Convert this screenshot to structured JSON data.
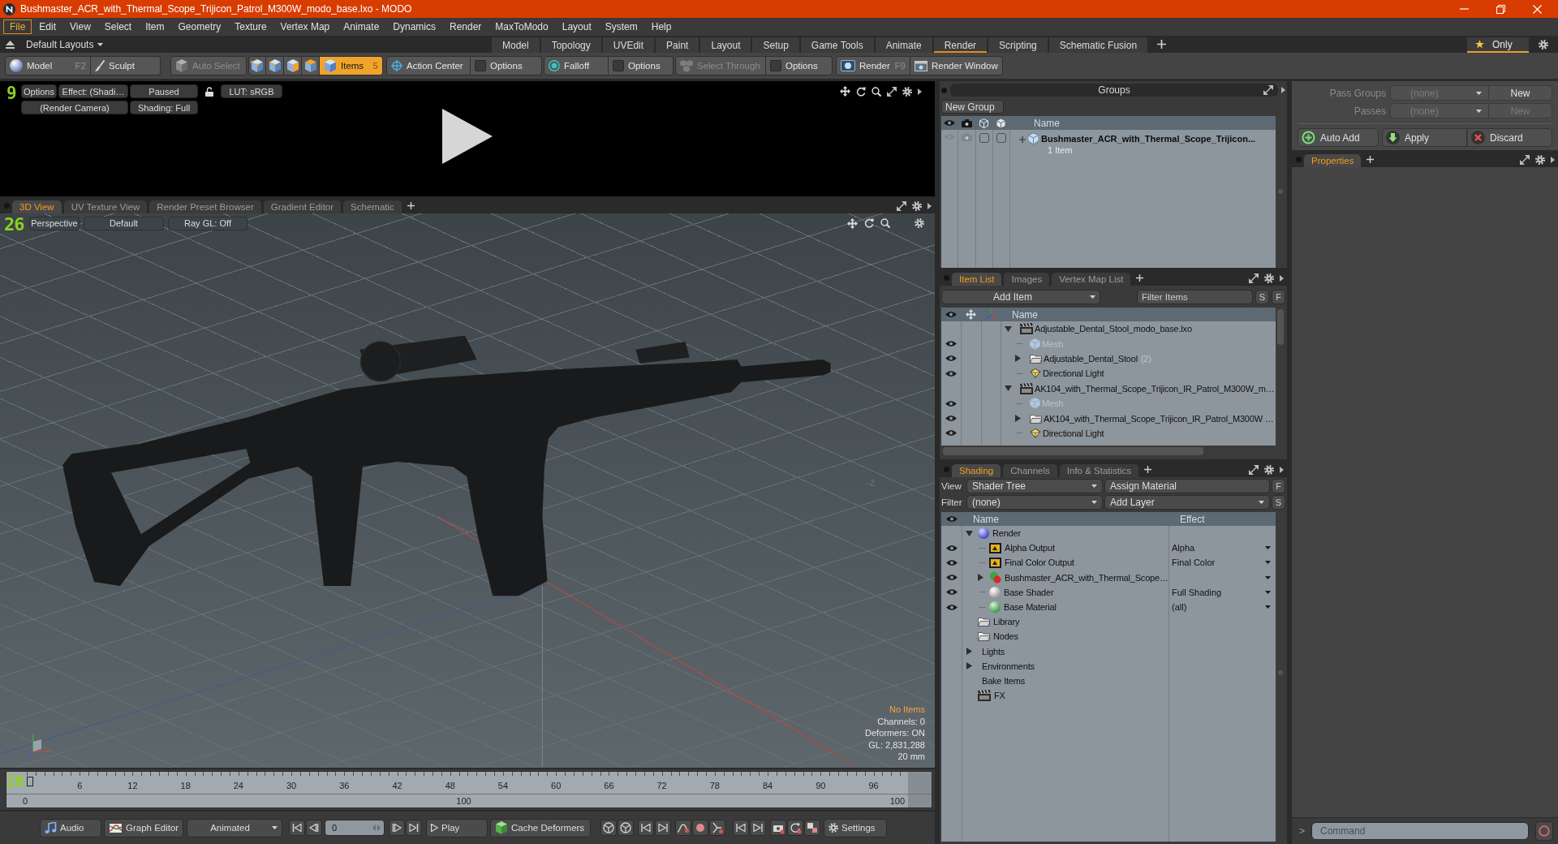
{
  "window": {
    "title": "Bushmaster_ACR_with_Thermal_Scope_Trijicon_Patrol_M300W_modo_base.lxo - MODO"
  },
  "menu": [
    {
      "label": "File",
      "selected": true
    },
    {
      "label": "Edit",
      "selected": false
    },
    {
      "label": "View",
      "selected": false
    },
    {
      "label": "Select",
      "selected": false
    },
    {
      "label": "Item",
      "selected": false
    },
    {
      "label": "Geometry",
      "selected": false
    },
    {
      "label": "Texture",
      "selected": false
    },
    {
      "label": "Vertex Map",
      "selected": false
    },
    {
      "label": "Animate",
      "selected": false
    },
    {
      "label": "Dynamics",
      "selected": false
    },
    {
      "label": "Render",
      "selected": false
    },
    {
      "label": "MaxToModo",
      "selected": false
    },
    {
      "label": "Layout",
      "selected": false
    },
    {
      "label": "System",
      "selected": false
    },
    {
      "label": "Help",
      "selected": false
    }
  ],
  "layout_bar": {
    "layouts": "Default Layouts",
    "tabs": [
      {
        "label": "Model",
        "selected": false
      },
      {
        "label": "Topology",
        "selected": false
      },
      {
        "label": "UVEdit",
        "selected": false
      },
      {
        "label": "Paint",
        "selected": false
      },
      {
        "label": "Layout",
        "selected": false
      },
      {
        "label": "Setup",
        "selected": false
      },
      {
        "label": "Game Tools",
        "selected": false
      },
      {
        "label": "Animate",
        "selected": false
      },
      {
        "label": "Render",
        "selected": true
      },
      {
        "label": "Scripting",
        "selected": false
      },
      {
        "label": "Schematic Fusion",
        "selected": false
      }
    ],
    "favorites": "Only"
  },
  "toolbar": [
    [
      {
        "label": "Model",
        "shortcut": "F2",
        "disabled": false
      },
      {
        "label": "Sculpt",
        "disabled": false
      }
    ],
    [
      {
        "label": "Auto Select",
        "disabled": true
      }
    ],
    [
      {
        "selected": false
      },
      {
        "selected": false
      },
      {
        "selected": false
      },
      {
        "selected": false
      },
      {
        "label": "Items",
        "shortcut": "5",
        "selected": true
      }
    ],
    [
      {
        "label": "Action Center",
        "disabled": false
      },
      {
        "label": "Options",
        "checked": false,
        "disabled": false
      }
    ],
    [
      {
        "label": "Falloff",
        "disabled": false
      },
      {
        "label": "Options",
        "checked": false,
        "disabled": false
      }
    ],
    [
      {
        "label": "Select Through",
        "disabled": true
      },
      {
        "label": "Options",
        "checked": false,
        "disabled": false
      }
    ],
    [
      {
        "label": "Render",
        "shortcut": "F9",
        "disabled": false
      },
      {
        "label": "Render Window",
        "disabled": false
      }
    ]
  ],
  "render_preview": {
    "fps_counter": "9",
    "controls": {
      "options": "Options",
      "effect": "Effect: (Shadi…",
      "state": "Paused",
      "lut": "LUT: sRGB",
      "camera": "(Render Camera)",
      "shading": "Shading: Full"
    }
  },
  "view_tabs": [
    {
      "label": "3D View",
      "selected": true
    },
    {
      "label": "UV Texture View",
      "selected": false
    },
    {
      "label": "Render Preset Browser",
      "selected": false
    },
    {
      "label": "Gradient Editor",
      "selected": false
    },
    {
      "label": "Schematic",
      "selected": false
    }
  ],
  "viewport": {
    "fps_counter": "26",
    "controls": [
      "Perspective",
      "Default",
      "Ray GL: Off"
    ],
    "axis_label": "-Z",
    "info": [
      {
        "kind": "warning",
        "text": "No Items"
      },
      {
        "kind": "stat",
        "text": "Channels: 0"
      },
      {
        "kind": "stat",
        "text": "Deformers: ON"
      },
      {
        "kind": "stat",
        "text": "GL: 2,831,288"
      },
      {
        "kind": "stat",
        "text": "20 mm"
      }
    ]
  },
  "timeline": {
    "fps_counter": "26",
    "ticks": [
      "6",
      "12",
      "18",
      "24",
      "30",
      "36",
      "42",
      "48",
      "54",
      "60",
      "66",
      "72",
      "78",
      "84",
      "90",
      "96"
    ],
    "range_labels": [
      "0",
      "100",
      "100"
    ]
  },
  "transport": {
    "audio": "Audio",
    "graph_editor": "Graph Editor",
    "mode": "Animated",
    "frame": "0",
    "play": "Play",
    "cache": "Cache Deformers",
    "settings": "Settings"
  },
  "groups": {
    "title": "Groups",
    "new_group": "New Group",
    "columns": [
      "Name"
    ],
    "rows": [
      {
        "name": "Bushmaster_ACR_with_Thermal_Scope_Trijicon...",
        "detail": "1 Item"
      }
    ]
  },
  "item_list": {
    "tabs": [
      {
        "label": "Item List",
        "selected": true
      },
      {
        "label": "Images",
        "selected": false
      },
      {
        "label": "Vertex Map List",
        "selected": false
      }
    ],
    "add_item": "Add Item",
    "filter": {
      "placeholder": "Filter Items"
    },
    "buttons": [
      "S",
      "F"
    ],
    "columns": [
      "Name"
    ],
    "items": [
      {
        "kind": "scene",
        "name": "Adjustable_Dental_Stool_modo_base.lxo",
        "expanded": true,
        "children": [
          {
            "kind": "mesh",
            "name": "Mesh",
            "visible": true,
            "disabled": true
          },
          {
            "kind": "group",
            "name": "Adjustable_Dental_Stool",
            "count": "(2)",
            "visible": true,
            "disabled": false,
            "expanded": false
          },
          {
            "kind": "light",
            "name": "Directional Light",
            "visible": true,
            "disabled": false
          }
        ]
      },
      {
        "kind": "scene",
        "name": "AK104_with_Thermal_Scope_Trijicon_IR_Patrol_M300W_m…",
        "expanded": true,
        "children": [
          {
            "kind": "mesh",
            "name": "Mesh",
            "visible": true,
            "disabled": true
          },
          {
            "kind": "group",
            "name": "AK104_with_Thermal_Scope_Trijicon_IR_Patrol_M300W …",
            "visible": true,
            "disabled": false,
            "expanded": false
          },
          {
            "kind": "light",
            "name": "Directional Light",
            "visible": true,
            "disabled": false
          }
        ]
      }
    ]
  },
  "shading": {
    "tabs": [
      {
        "label": "Shading",
        "selected": true
      },
      {
        "label": "Channels",
        "selected": false
      },
      {
        "label": "Info & Statistics",
        "selected": false
      }
    ],
    "controls": [
      {
        "label": "View",
        "dropdown": "Shader Tree",
        "action": {
          "kind": "button",
          "label": "Assign Material"
        },
        "key": "F"
      },
      {
        "label": "Filter",
        "dropdown": "(none)",
        "action": {
          "kind": "dropdown",
          "label": "Add Layer"
        },
        "key": "S"
      }
    ],
    "columns": [
      "Name",
      "Effect"
    ],
    "items": [
      {
        "kind": "render",
        "name": "Render",
        "expanded": true,
        "children": [
          {
            "kind": "output",
            "name": "Alpha Output",
            "effect": "Alpha",
            "visible": true
          },
          {
            "kind": "output",
            "name": "Final Color Output",
            "effect": "Final Color",
            "visible": true
          },
          {
            "kind": "material_group",
            "name": "Bushmaster_ACR_with_Thermal_Scope…",
            "expanded": false,
            "visible": true
          },
          {
            "kind": "shader",
            "name": "Base Shader",
            "effect": "Full Shading",
            "visible": true
          },
          {
            "kind": "material",
            "name": "Base Material",
            "effect": "(all)",
            "visible": true
          }
        ]
      },
      {
        "kind": "folder",
        "name": "Library"
      },
      {
        "kind": "folder",
        "name": "Nodes"
      },
      {
        "kind": "category",
        "name": "Lights",
        "expanded": false
      },
      {
        "kind": "category",
        "name": "Environments",
        "expanded": false
      },
      {
        "kind": "category",
        "name": "Bake Items"
      },
      {
        "kind": "scene",
        "name": "FX"
      }
    ]
  },
  "properties": {
    "pass_rows": [
      {
        "label": "Pass Groups",
        "value": "(none)",
        "button": {
          "label": "New",
          "disabled": false
        }
      },
      {
        "label": "Passes",
        "value": "(none)",
        "button": {
          "label": "New",
          "disabled": true
        }
      }
    ],
    "actions": [
      "Auto Add",
      "Apply",
      "Discard"
    ],
    "tabs": [
      {
        "label": "Properties",
        "selected": true
      }
    ],
    "command": {
      "prompt": ">",
      "placeholder": "Command"
    }
  }
}
